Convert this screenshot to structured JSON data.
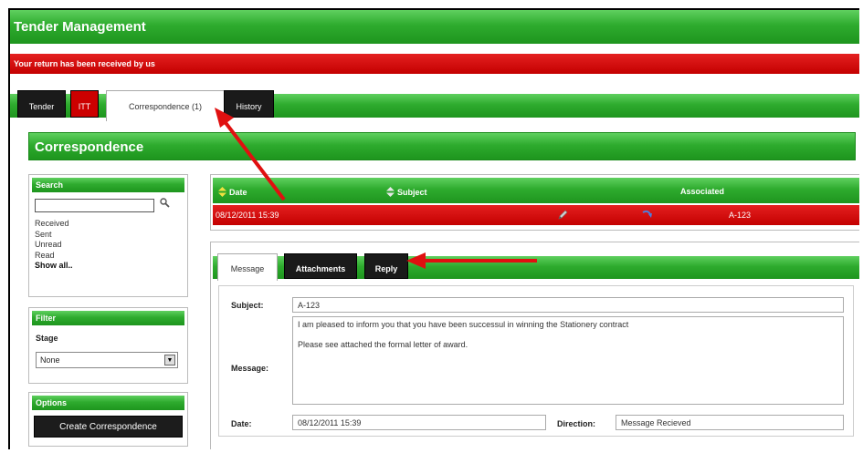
{
  "app": {
    "title": "Tender Management"
  },
  "alert": {
    "text": "Your return has been received by us"
  },
  "tabs": [
    {
      "label": "Tender"
    },
    {
      "label": "ITT"
    },
    {
      "label": "Correspondence (1)"
    },
    {
      "label": "History"
    }
  ],
  "section": {
    "title": "Correspondence"
  },
  "search": {
    "header": "Search",
    "value": "",
    "links": [
      "Received",
      "Sent",
      "Unread",
      "Read"
    ],
    "show_all": "Show all.."
  },
  "filter": {
    "header": "Filter",
    "stage_label": "Stage",
    "stage_value": "None"
  },
  "options": {
    "header": "Options",
    "create_button": "Create Correspondence"
  },
  "list": {
    "columns": [
      "Date",
      "Subject",
      "Associated"
    ],
    "rows": [
      {
        "date": "08/12/2011 15:39",
        "subject": "",
        "associated": "A-123"
      }
    ]
  },
  "message_tabs": [
    "Message",
    "Attachments",
    "Reply"
  ],
  "form": {
    "subject_label": "Subject:",
    "subject_value": "A-123",
    "message_label": "Message:",
    "message_value": "I am pleased to inform you that you have been successul in winning the Stationery contract\n\nPlease see attached the formal letter of award.",
    "date_label": "Date:",
    "date_value": "08/12/2011 15:39",
    "direction_label": "Direction:",
    "direction_value": "Message Recieved"
  },
  "colors": {
    "brand_green": "#2eab2e",
    "alert_red": "#c40000",
    "tab_dark": "#1a1a1a",
    "annotation_arrow": "#e01010"
  },
  "icons": [
    "search-icon",
    "sort-icon",
    "edit-pencil-icon",
    "reply-arrow-icon",
    "chevron-down-icon"
  ]
}
